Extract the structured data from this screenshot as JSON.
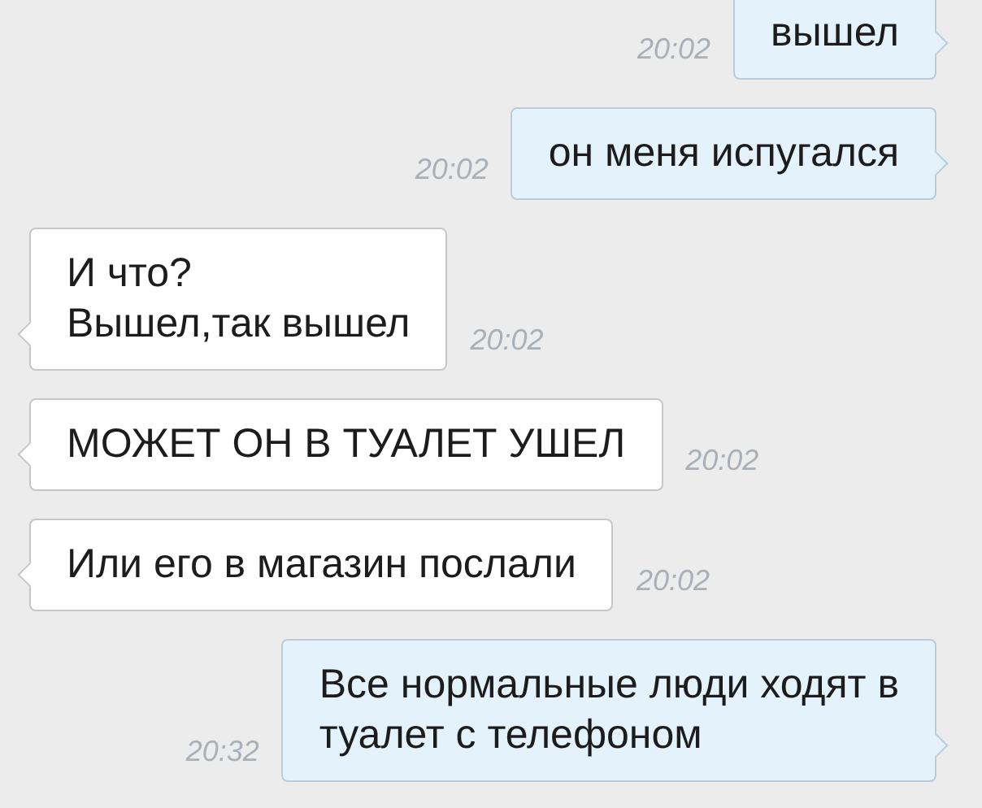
{
  "messages": [
    {
      "kind": "outgoing",
      "text": "вышел",
      "time": "20:02"
    },
    {
      "kind": "outgoing",
      "text": "он меня испугался",
      "time": "20:02"
    },
    {
      "kind": "incoming",
      "text": "И что?\nВышел,так вышел",
      "time": "20:02"
    },
    {
      "kind": "incoming",
      "text": "МОЖЕТ ОН В ТУАЛЕТ УШЕЛ",
      "time": "20:02"
    },
    {
      "kind": "incoming",
      "text": "Или его в магазин послали",
      "time": "20:02"
    },
    {
      "kind": "outgoing",
      "text": "Все нормальные люди ходят в\nтуалет с телефоном",
      "time": "20:32"
    }
  ]
}
